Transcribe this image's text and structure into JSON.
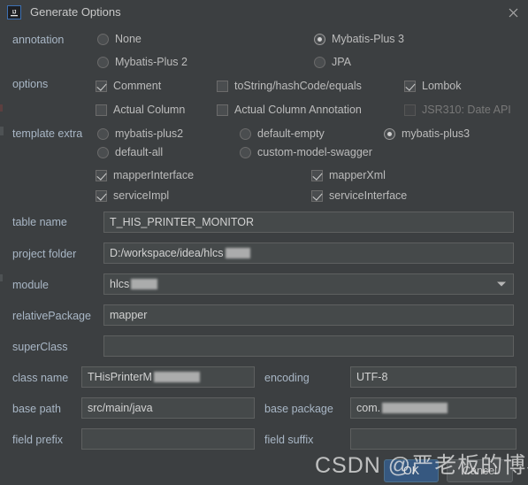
{
  "window": {
    "title": "Generate Options",
    "app_icon": "intellij-idea-icon",
    "close_icon": "close-icon"
  },
  "sections": {
    "annotation": {
      "label": "annotation",
      "options": [
        {
          "label": "None",
          "selected": false
        },
        {
          "label": "Mybatis-Plus 3",
          "selected": true
        },
        {
          "label": "Mybatis-Plus 2",
          "selected": false
        },
        {
          "label": "JPA",
          "selected": false
        }
      ]
    },
    "options": {
      "label": "options",
      "items": [
        {
          "label": "Comment",
          "checked": true,
          "disabled": false
        },
        {
          "label": "toString/hashCode/equals",
          "checked": false,
          "disabled": false
        },
        {
          "label": "Lombok",
          "checked": true,
          "disabled": false
        },
        {
          "label": "Actual Column",
          "checked": false,
          "disabled": false
        },
        {
          "label": "Actual Column Annotation",
          "checked": false,
          "disabled": false
        },
        {
          "label": "JSR310: Date API",
          "checked": false,
          "disabled": true
        }
      ]
    },
    "template_extra": {
      "label": "template extra",
      "options": [
        {
          "label": "mybatis-plus2",
          "selected": false
        },
        {
          "label": "default-empty",
          "selected": false
        },
        {
          "label": "mybatis-plus3",
          "selected": true
        },
        {
          "label": "default-all",
          "selected": false
        },
        {
          "label": "custom-model-swagger",
          "selected": false
        }
      ]
    },
    "generate": {
      "items": [
        {
          "label": "mapperInterface",
          "checked": true
        },
        {
          "label": "mapperXml",
          "checked": true
        },
        {
          "label": "serviceImpl",
          "checked": true
        },
        {
          "label": "serviceInterface",
          "checked": true
        }
      ]
    }
  },
  "fields": {
    "table_name": {
      "label": "table name",
      "value": "T_HIS_PRINTER_MONITOR"
    },
    "project_folder": {
      "label": "project folder",
      "value": "D:/workspace/idea/hlcs"
    },
    "module": {
      "label": "module",
      "value": "hlcs"
    },
    "relative_package": {
      "label": "relativePackage",
      "value": "mapper"
    },
    "super_class": {
      "label": "superClass",
      "value": ""
    },
    "class_name": {
      "label": "class name",
      "value": "THisPrinterM"
    },
    "encoding": {
      "label": "encoding",
      "value": "UTF-8"
    },
    "base_path": {
      "label": "base path",
      "value": "src/main/java"
    },
    "base_package": {
      "label": "base package",
      "value": "com."
    },
    "field_prefix": {
      "label": "field prefix",
      "value": ""
    },
    "field_suffix": {
      "label": "field suffix",
      "value": ""
    }
  },
  "buttons": {
    "ok": "OK",
    "cancel": "Cancel"
  },
  "watermark": "CSDN @严老板的博客"
}
